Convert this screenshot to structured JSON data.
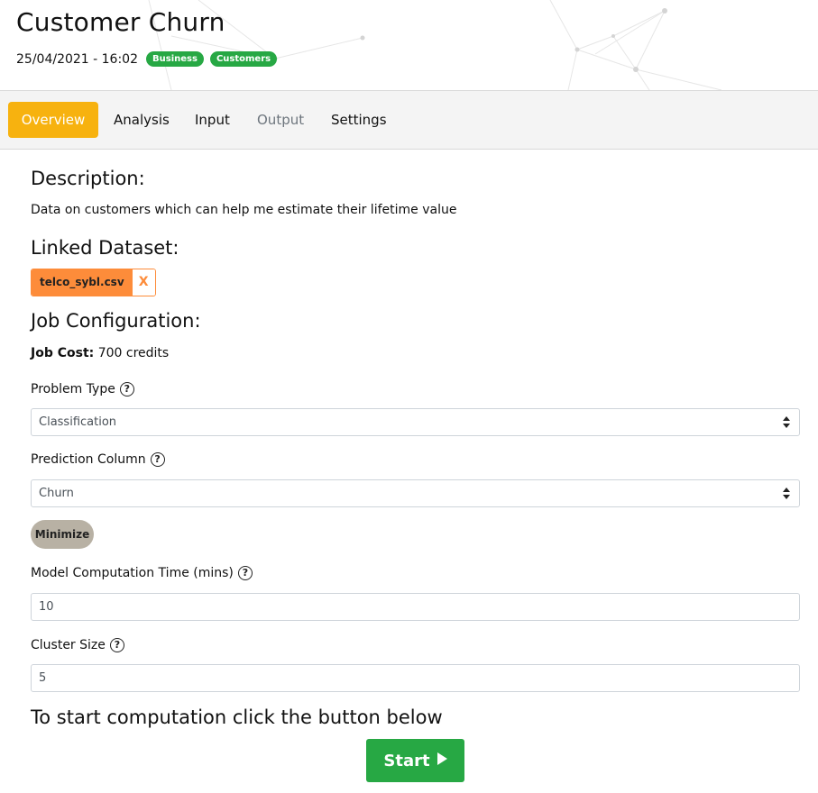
{
  "header": {
    "title": "Customer Churn",
    "date": "25/04/2021 - 16:02",
    "tags": [
      "Business",
      "Customers"
    ]
  },
  "tabs": [
    {
      "label": "Overview",
      "state": "active"
    },
    {
      "label": "Analysis",
      "state": "normal"
    },
    {
      "label": "Input",
      "state": "normal"
    },
    {
      "label": "Output",
      "state": "disabled"
    },
    {
      "label": "Settings",
      "state": "normal"
    }
  ],
  "description": {
    "heading": "Description:",
    "text": "Data on customers which can help me estimate their lifetime value"
  },
  "linked_dataset": {
    "heading": "Linked Dataset:",
    "file": "telco_sybl.csv",
    "remove_label": "X"
  },
  "job_config": {
    "heading": "Job Configuration:",
    "cost_label": "Job Cost:",
    "cost_value": "700 credits",
    "problem_type": {
      "label": "Problem Type",
      "value": "Classification"
    },
    "prediction_column": {
      "label": "Prediction Column",
      "value": "Churn"
    },
    "minimize_label": "Minimize",
    "computation_time": {
      "label": "Model Computation Time (mins)",
      "value": "10"
    },
    "cluster_size": {
      "label": "Cluster Size",
      "value": "5"
    },
    "help_glyph": "?"
  },
  "start": {
    "prompt": "To start computation click the button below",
    "button_label": "Start",
    "icon": "play-icon"
  },
  "colors": {
    "accent": "#f7b20f",
    "tag_green": "#27a844",
    "dataset_orange": "#fd8c3a",
    "minimize_grey": "#b8b1a4"
  }
}
